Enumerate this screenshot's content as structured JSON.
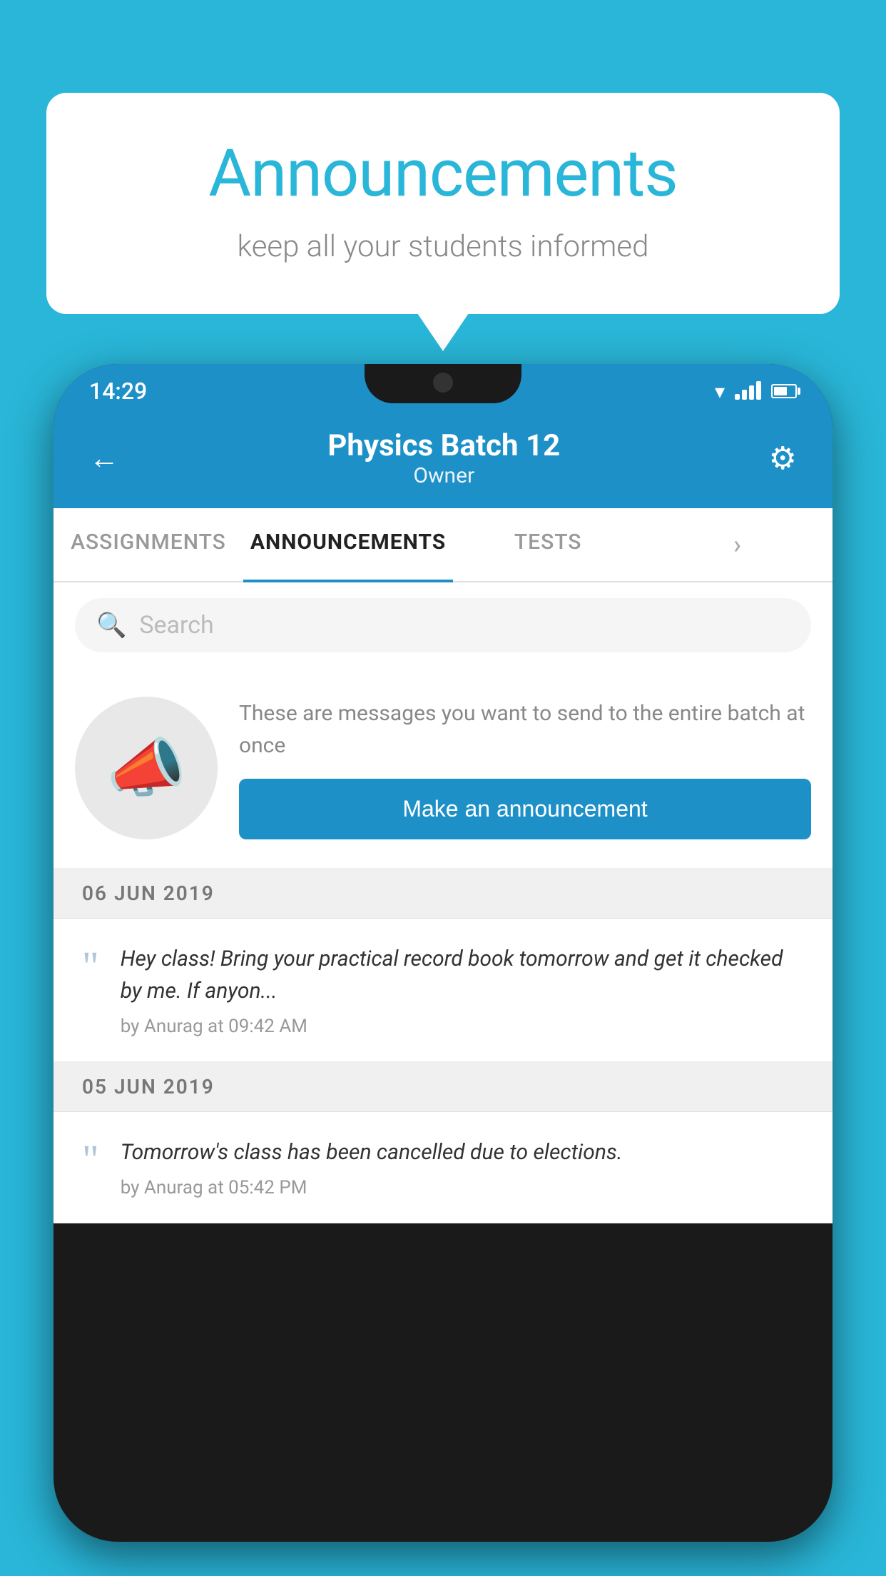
{
  "bubble": {
    "title": "Announcements",
    "subtitle": "keep all your students informed"
  },
  "status_bar": {
    "time": "14:29"
  },
  "header": {
    "title": "Physics Batch 12",
    "subtitle": "Owner"
  },
  "tabs": [
    {
      "label": "ASSIGNMENTS",
      "active": false
    },
    {
      "label": "ANNOUNCEMENTS",
      "active": true
    },
    {
      "label": "TESTS",
      "active": false
    },
    {
      "label": "...",
      "active": false
    }
  ],
  "search": {
    "placeholder": "Search"
  },
  "announcement_prompt": {
    "description": "These are messages you want to send to the entire batch at once",
    "button_label": "Make an announcement"
  },
  "announcements": [
    {
      "date": "06  JUN  2019",
      "message": "Hey class! Bring your practical record book tomorrow and get it checked by me. If anyon...",
      "meta": "by Anurag at 09:42 AM"
    },
    {
      "date": "05  JUN  2019",
      "message": "Tomorrow's class has been cancelled due to elections.",
      "meta": "by Anurag at 05:42 PM"
    }
  ],
  "colors": {
    "primary": "#1e90c8",
    "background": "#29b6d8",
    "white": "#ffffff"
  }
}
